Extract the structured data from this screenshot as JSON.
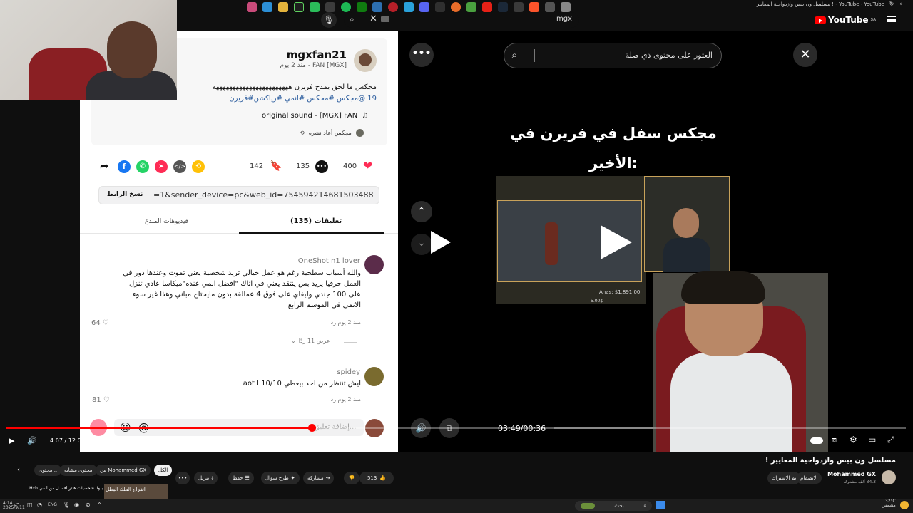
{
  "browser": {
    "tab_title": "مسلسل ون بيس وازدواجية المعايير ! - YouTube - YouTube",
    "logo_text": "YouTube",
    "logo_region": "SA",
    "search_value": "mgx"
  },
  "tiktok": {
    "author_name": "mgxfan21",
    "author_meta": "FAN [MGX] - منذ 2 يوم",
    "caption_line1": "مجكس ما لحق يمدح فريرن هههههههههههههههههههههههه",
    "caption_line2": "19 @مجكس #مجكس #انمي #رياكشن#فريرن",
    "sound": "original sound - [MGX] FAN",
    "repost_label": "مجكس أعاد نشره",
    "likes": "400",
    "comments": "135",
    "saves": "142",
    "copy_link_label": "نسخ الرابط",
    "link_url": "=1&sender_device=pc&web_id=7545942146815034888",
    "tab_comments": "تعليقات (135)",
    "tab_creator_videos": "فيديوهات المبدع",
    "comment1_user": "OneShot n1 lover",
    "comment1_text": "والله أسباب سطحية رغم هو عمل خيالي تريد شخصية يعني تموت وعندها دور في العمل حرفيا يريد بس ينتقد يعني في اتاك \"افضل انمي عنده\"ميكاسا عادي تنزل على 100 جندي وليفاي على فوق 4 عمالقة بدون مايحتاج مباني وهذا غير سوء الانمي في الموسم الرابع",
    "comment1_meta": "منذ 2 يوم   رد",
    "comment1_likes": "64",
    "view_replies": "عرض 11 ردًا",
    "comment2_user": "spidey",
    "comment2_text": "ايش تنتظر من احد بيعطي 10/10 لـaot",
    "comment2_meta": "منذ 2 يوم   رد",
    "comment2_likes": "81",
    "add_comment_placeholder": "إضافة تعليق..."
  },
  "video_panel": {
    "search_placeholder": "العثور على محتوى ذي صلة",
    "headline_line1": "مجكس سفل في فريرن في",
    "headline_line2": "الأخير:",
    "game_stat_text": "Anas: $1,891.00",
    "game_stat_small": "5.00$",
    "tiktok_time": "03:49/00:36"
  },
  "player": {
    "time": "4:07 / 12:01",
    "progress_fraction": 0.34
  },
  "below_video": {
    "video_title": "مسلسل ون بيس وازدواجية المعايير !",
    "channel_name": "Mohammed GX",
    "subscribers": "34.3 ألف مشترك",
    "join_label": "الانضمام",
    "subscribed_label": "تم الاشتراك",
    "likes_label": "513",
    "share_label": "مشاركة",
    "ask_label": "طرح سؤال",
    "save_label": "حفظ",
    "download_label": "تنزيل",
    "chips": [
      "الكل",
      "من Mohammed GX",
      "محتوى مشابه",
      "محتوى..."
    ],
    "rec_title": "بلولـ شخصيات هنتر أفسـل من أنمي Hxh",
    "rec_thumb": "انفراج الملك البطل"
  },
  "taskbar": {
    "search_label": "بحث",
    "lang": "ENG",
    "clock_time": "4:14 ص",
    "clock_date": "2025/9/11",
    "weather_temp": "32°C",
    "weather_desc": "مشمس"
  }
}
